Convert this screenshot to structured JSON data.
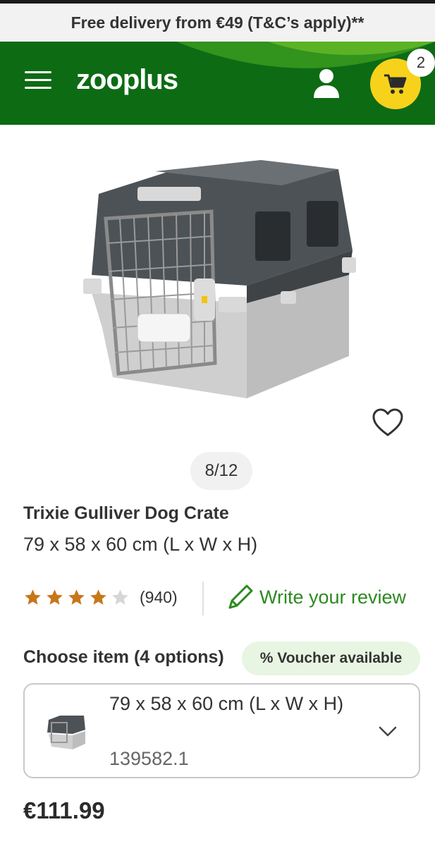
{
  "promo_banner": {
    "text": "Free delivery from €49 (T&C’s apply)**"
  },
  "header": {
    "logo": "zooplus",
    "cart_count": "2"
  },
  "gallery": {
    "counter": "8/12"
  },
  "product": {
    "title": "Trixie Gulliver Dog Crate",
    "subtitle": "79 x 58 x 60 cm (L x W x H)"
  },
  "rating": {
    "stars": 4,
    "max": 5,
    "count": "(940)",
    "review_link": "Write your review"
  },
  "options": {
    "label": "Choose item (4 options)",
    "voucher": "% Voucher available",
    "selected": {
      "size": "79 x 58 x 60 cm (L x W x H)",
      "sku": "139582.1"
    }
  },
  "price": "€111.99",
  "colors": {
    "brand_green": "#0d6b14",
    "cart_yellow": "#f7d21b",
    "review_green": "#2b8a1e",
    "star_gold": "#c8761a"
  },
  "icons": [
    "menu-icon",
    "user-icon",
    "cart-icon",
    "heart-icon",
    "star-icon",
    "pencil-icon",
    "chevron-down-icon"
  ]
}
